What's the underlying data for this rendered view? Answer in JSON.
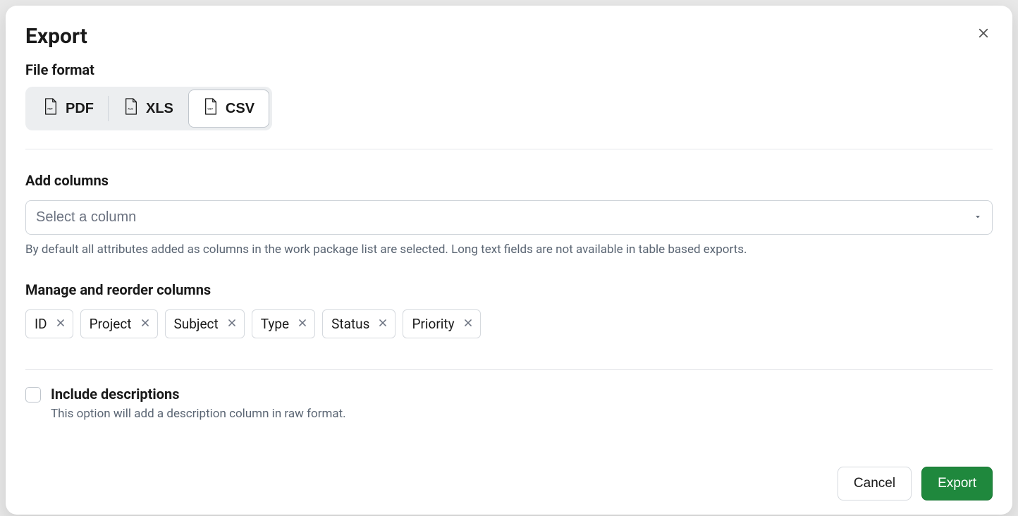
{
  "modal": {
    "title": "Export",
    "file_format_label": "File format",
    "formats": [
      {
        "key": "pdf",
        "label": "PDF",
        "badge": "PDF",
        "selected": false
      },
      {
        "key": "xls",
        "label": "XLS",
        "badge": "XLS",
        "selected": false
      },
      {
        "key": "csv",
        "label": "CSV",
        "badge": "CSV",
        "selected": true
      }
    ],
    "add_columns_label": "Add columns",
    "add_columns_placeholder": "Select a column",
    "add_columns_hint": "By default all attributes added as columns in the work package list are selected. Long text fields are not available in table based exports.",
    "manage_columns_label": "Manage and reorder columns",
    "columns": [
      {
        "key": "id",
        "label": "ID"
      },
      {
        "key": "project",
        "label": "Project"
      },
      {
        "key": "subject",
        "label": "Subject"
      },
      {
        "key": "type",
        "label": "Type"
      },
      {
        "key": "status",
        "label": "Status"
      },
      {
        "key": "priority",
        "label": "Priority"
      }
    ],
    "include_descriptions": {
      "checked": false,
      "label": "Include descriptions",
      "hint": "This option will add a description column in raw format."
    },
    "buttons": {
      "cancel": "Cancel",
      "export": "Export"
    }
  }
}
